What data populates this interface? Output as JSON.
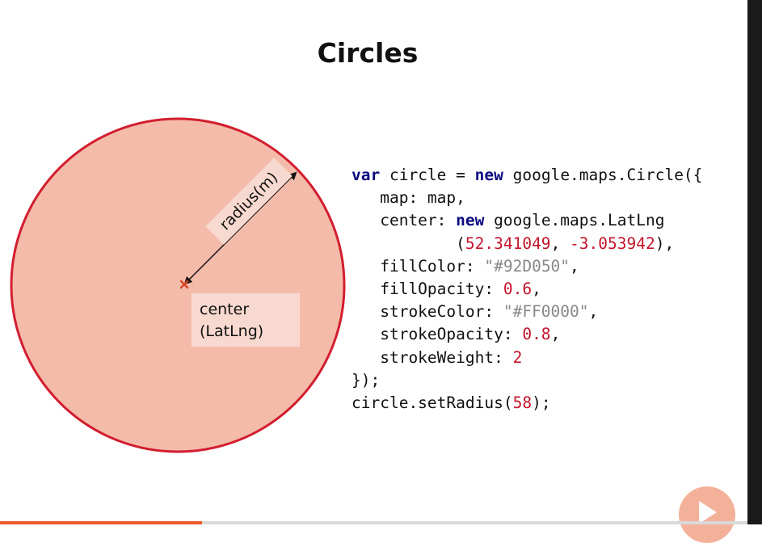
{
  "slide": {
    "title": "Circles"
  },
  "diagram": {
    "radius_label": "radius(m)",
    "center_label_line1": "center",
    "center_label_line2": "(LatLng)",
    "colors": {
      "fill": "#F4BBAA",
      "stroke": "#D21E2F",
      "center_marker": "#D6492A"
    },
    "icons": [
      "center-x-icon",
      "radius-arrow-icon"
    ]
  },
  "code": {
    "kw_var": "var",
    "circle_decl": " circle = ",
    "kw_new1": "new",
    "circle_ctor": " google.maps.Circle({",
    "map_line": "   map: map,",
    "center_prefix": "   center: ",
    "kw_new2": "new",
    "latlng_ctor": " google.maps.LatLng",
    "coord_indent": "           (",
    "lat": "52.341049",
    "coord_sep": ", ",
    "lng": "-3.053942",
    "coord_close": "),",
    "fillcolor_key": "   fillColor: ",
    "fillcolor_val": "\"#92D050\"",
    "fillcolor_end": ",",
    "fillopacity_key": "   fillOpacity: ",
    "fillopacity_val": "0.6",
    "fillopacity_end": ",",
    "strokecolor_key": "   strokeColor: ",
    "strokecolor_val": "\"#FF0000\"",
    "strokecolor_end": ",",
    "strokeopacity_key": "   strokeOpacity: ",
    "strokeopacity_val": "0.8",
    "strokeopacity_end": ",",
    "strokeweight_key": "   strokeWeight: ",
    "strokeweight_val": "2",
    "close_line": "});",
    "setradius_prefix": "circle.setRadius(",
    "setradius_val": "58",
    "setradius_end": ");"
  },
  "player": {
    "progress": 0.27,
    "play_icon": "play-icon",
    "accent": "#F05A28"
  }
}
